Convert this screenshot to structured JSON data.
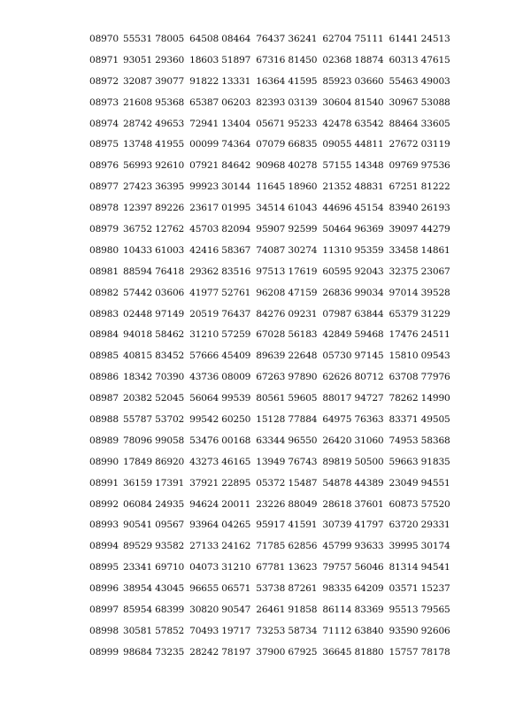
{
  "rows": [
    {
      "index": "08970",
      "groups": [
        "55531 78005",
        "64508 08464",
        "76437 36241",
        "62704 75111",
        "61441 24513"
      ]
    },
    {
      "index": "08971",
      "groups": [
        "93051 29360",
        "18603 51897",
        "67316 81450",
        "02368 18874",
        "60313 47615"
      ]
    },
    {
      "index": "08972",
      "groups": [
        "32087 39077",
        "91822 13331",
        "16364 41595",
        "85923 03660",
        "55463 49003"
      ]
    },
    {
      "index": "08973",
      "groups": [
        "21608 95368",
        "65387 06203",
        "82393 03139",
        "30604 81540",
        "30967 53088"
      ]
    },
    {
      "index": "08974",
      "groups": [
        "28742 49653",
        "72941 13404",
        "05671 95233",
        "42478 63542",
        "88464 33605"
      ]
    },
    {
      "index": "08975",
      "groups": [
        "13748 41955",
        "00099 74364",
        "07079 66835",
        "09055 44811",
        "27672 03119"
      ]
    },
    {
      "index": "08976",
      "groups": [
        "56993 92610",
        "07921 84642",
        "90968 40278",
        "57155 14348",
        "09769 97536"
      ]
    },
    {
      "index": "08977",
      "groups": [
        "27423 36395",
        "99923 30144",
        "11645 18960",
        "21352 48831",
        "67251 81222"
      ]
    },
    {
      "index": "08978",
      "groups": [
        "12397 89226",
        "23617 01995",
        "34514 61043",
        "44696 45154",
        "83940 26193"
      ]
    },
    {
      "index": "08979",
      "groups": [
        "36752 12762",
        "45703 82094",
        "95907 92599",
        "50464 96369",
        "39097 44279"
      ]
    },
    {
      "index": "08980",
      "groups": [
        "10433 61003",
        "42416 58367",
        "74087 30274",
        "11310 95359",
        "33458 14861"
      ]
    },
    {
      "index": "08981",
      "groups": [
        "88594 76418",
        "29362 83516",
        "97513 17619",
        "60595 92043",
        "32375 23067"
      ]
    },
    {
      "index": "08982",
      "groups": [
        "57442 03606",
        "41977 52761",
        "96208 47159",
        "26836 99034",
        "97014 39528"
      ]
    },
    {
      "index": "08983",
      "groups": [
        "02448 97149",
        "20519 76437",
        "84276 09231",
        "07987 63844",
        "65379 31229"
      ]
    },
    {
      "index": "08984",
      "groups": [
        "94018 58462",
        "31210 57259",
        "67028 56183",
        "42849 59468",
        "17476 24511"
      ]
    },
    {
      "index": "08985",
      "groups": [
        "40815 83452",
        "57666 45409",
        "89639 22648",
        "05730 97145",
        "15810 09543"
      ]
    },
    {
      "index": "08986",
      "groups": [
        "18342 70390",
        "43736 08009",
        "67263 97890",
        "62626 80712",
        "63708 77976"
      ]
    },
    {
      "index": "08987",
      "groups": [
        "20382 52045",
        "56064 99539",
        "80561 59605",
        "88017 94727",
        "78262 14990"
      ]
    },
    {
      "index": "08988",
      "groups": [
        "55787 53702",
        "99542 60250",
        "15128 77884",
        "64975 76363",
        "83371 49505"
      ]
    },
    {
      "index": "08989",
      "groups": [
        "78096 99058",
        "53476 00168",
        "63344 96550",
        "26420 31060",
        "74953 58368"
      ]
    },
    {
      "index": "08990",
      "groups": [
        "17849 86920",
        "43273 46165",
        "13949 76743",
        "89819 50500",
        "59663 91835"
      ]
    },
    {
      "index": "08991",
      "groups": [
        "36159 17391",
        "37921 22895",
        "05372 15487",
        "54878 44389",
        "23049 94551"
      ]
    },
    {
      "index": "08992",
      "groups": [
        "06084 24935",
        "94624 20011",
        "23226 88049",
        "28618 37601",
        "60873 57520"
      ]
    },
    {
      "index": "08993",
      "groups": [
        "90541 09567",
        "93964 04265",
        "95917 41591",
        "30739 41797",
        "63720 29331"
      ]
    },
    {
      "index": "08994",
      "groups": [
        "89529 93582",
        "27133 24162",
        "71785 62856",
        "45799 93633",
        "39995 30174"
      ]
    },
    {
      "index": "08995",
      "groups": [
        "23341 69710",
        "04073 31210",
        "67781 13623",
        "79757 56046",
        "81314 94541"
      ]
    },
    {
      "index": "08996",
      "groups": [
        "38954 43045",
        "96655 06571",
        "53738 87261",
        "98335 64209",
        "03571 15237"
      ]
    },
    {
      "index": "08997",
      "groups": [
        "85954 68399",
        "30820 90547",
        "26461 91858",
        "86114 83369",
        "95513 79565"
      ]
    },
    {
      "index": "08998",
      "groups": [
        "30581 57852",
        "70493 19717",
        "73253 58734",
        "71112 63840",
        "93590 92606"
      ]
    },
    {
      "index": "08999",
      "groups": [
        "98684 73235",
        "28242 78197",
        "37900 67925",
        "36645 81880",
        "15757 78178"
      ]
    }
  ]
}
